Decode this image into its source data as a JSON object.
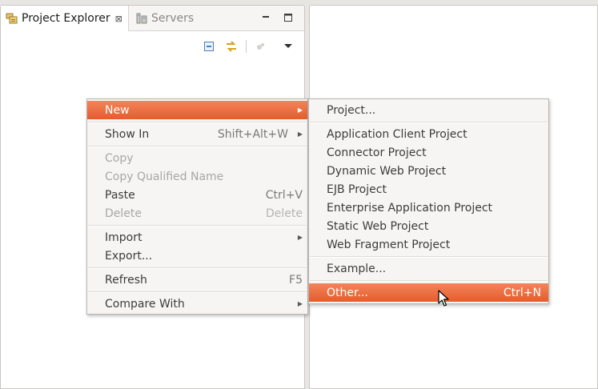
{
  "view": {
    "tabs": [
      {
        "label": "Project Explorer",
        "icon": "project-explorer-icon",
        "active": true
      },
      {
        "label": "Servers",
        "icon": "servers-icon",
        "active": false
      }
    ],
    "close_glyph": "⊠"
  },
  "context_menu": {
    "items": [
      {
        "label": "New",
        "accel": "",
        "submenu": true,
        "disabled": false,
        "highlighted": true
      },
      {
        "label": "Show In",
        "accel": "Shift+Alt+W",
        "submenu": true,
        "disabled": false
      },
      {
        "label": "Copy",
        "accel": "",
        "disabled": true
      },
      {
        "label": "Copy Qualified Name",
        "accel": "",
        "disabled": true
      },
      {
        "label": "Paste",
        "accel": "Ctrl+V",
        "disabled": false
      },
      {
        "label": "Delete",
        "accel": "Delete",
        "disabled": true
      },
      {
        "label": "Import",
        "accel": "",
        "submenu": true,
        "disabled": false
      },
      {
        "label": "Export...",
        "accel": "",
        "disabled": false
      },
      {
        "label": "Refresh",
        "accel": "F5",
        "disabled": false
      },
      {
        "label": "Compare With",
        "accel": "",
        "submenu": true,
        "disabled": false
      }
    ]
  },
  "new_submenu": {
    "items": [
      {
        "label": "Project..."
      },
      {
        "label": "Application Client Project"
      },
      {
        "label": "Connector Project"
      },
      {
        "label": "Dynamic Web Project"
      },
      {
        "label": "EJB Project"
      },
      {
        "label": "Enterprise Application Project"
      },
      {
        "label": "Static Web Project"
      },
      {
        "label": "Web Fragment Project"
      },
      {
        "label": "Example..."
      },
      {
        "label": "Other...",
        "accel": "Ctrl+N",
        "highlighted": true
      }
    ]
  },
  "colors": {
    "highlight_top": "#f4845a",
    "highlight_bottom": "#e35d2c",
    "menu_bg": "#f6f5f4"
  }
}
